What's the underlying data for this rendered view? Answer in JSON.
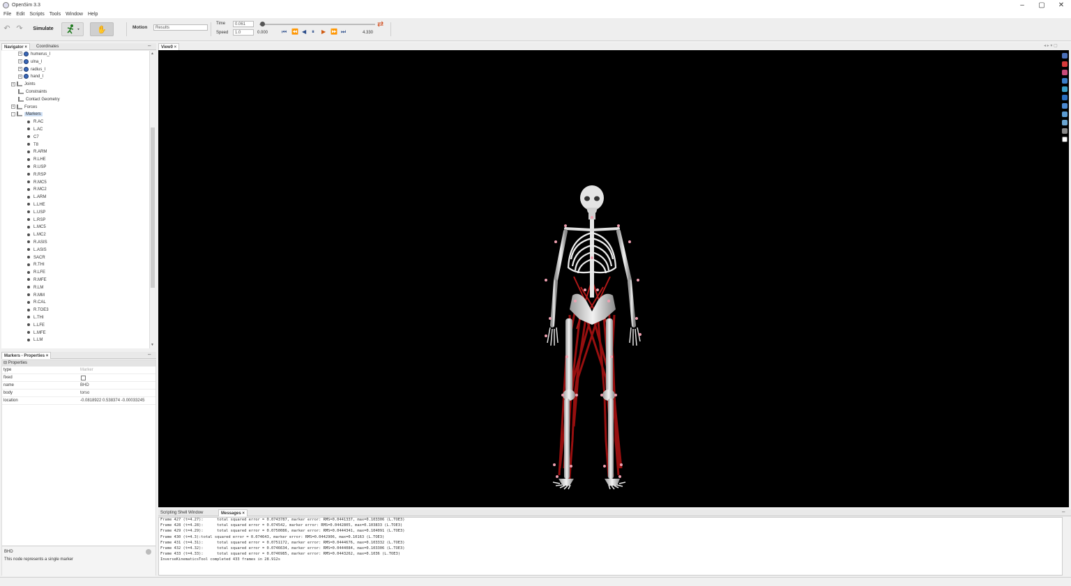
{
  "window": {
    "title": "OpenSim 3.3",
    "controls": [
      "–",
      "▢",
      "✕"
    ]
  },
  "menu": [
    "File",
    "Edit",
    "Scripts",
    "Tools",
    "Window",
    "Help"
  ],
  "toolbar": {
    "simulate_label": "Simulate",
    "motion_label": "Motion",
    "motion_value": "Results",
    "time_label": "Time",
    "time_value": "0.061",
    "speed_label": "Speed",
    "speed_value": "1.0",
    "range_start": "0.000",
    "range_end": "4.330"
  },
  "left_tabs": {
    "navigator": "Navigator",
    "coordinates": "Coordinates"
  },
  "tree": [
    {
      "label": "humerus_l",
      "kind": "body",
      "level": 2,
      "expander": "+"
    },
    {
      "label": "ulna_l",
      "kind": "body",
      "level": 2,
      "expander": "+"
    },
    {
      "label": "radius_l",
      "kind": "body",
      "level": 2,
      "expander": "+"
    },
    {
      "label": "hand_l",
      "kind": "body",
      "level": 2,
      "expander": "+"
    },
    {
      "label": "Joints",
      "kind": "group",
      "level": 1,
      "expander": "+"
    },
    {
      "label": "Constraints",
      "kind": "group",
      "level": 1,
      "expander": ""
    },
    {
      "label": "Contact Geometry",
      "kind": "group",
      "level": 1,
      "expander": ""
    },
    {
      "label": "Forces",
      "kind": "group",
      "level": 1,
      "expander": "+"
    },
    {
      "label": "Markers",
      "kind": "group",
      "level": 1,
      "expander": "-"
    },
    {
      "label": "R.AC",
      "kind": "marker",
      "level": 2
    },
    {
      "label": "L.AC",
      "kind": "marker",
      "level": 2
    },
    {
      "label": "C7",
      "kind": "marker",
      "level": 2
    },
    {
      "label": "T8",
      "kind": "marker",
      "level": 2
    },
    {
      "label": "R.ARM",
      "kind": "marker",
      "level": 2
    },
    {
      "label": "R.LHE",
      "kind": "marker",
      "level": 2
    },
    {
      "label": "R.USP",
      "kind": "marker",
      "level": 2
    },
    {
      "label": "R.RSP",
      "kind": "marker",
      "level": 2
    },
    {
      "label": "R.MC5",
      "kind": "marker",
      "level": 2
    },
    {
      "label": "R.MC2",
      "kind": "marker",
      "level": 2
    },
    {
      "label": "L.ARM",
      "kind": "marker",
      "level": 2
    },
    {
      "label": "L.LHE",
      "kind": "marker",
      "level": 2
    },
    {
      "label": "L.USP",
      "kind": "marker",
      "level": 2
    },
    {
      "label": "L.RSP",
      "kind": "marker",
      "level": 2
    },
    {
      "label": "L.MC5",
      "kind": "marker",
      "level": 2
    },
    {
      "label": "L.MC2",
      "kind": "marker",
      "level": 2
    },
    {
      "label": "R.ASIS",
      "kind": "marker",
      "level": 2
    },
    {
      "label": "L.ASIS",
      "kind": "marker",
      "level": 2
    },
    {
      "label": "SACR",
      "kind": "marker",
      "level": 2
    },
    {
      "label": "R.THI",
      "kind": "marker",
      "level": 2
    },
    {
      "label": "R.LFE",
      "kind": "marker",
      "level": 2
    },
    {
      "label": "R.MFE",
      "kind": "marker",
      "level": 2
    },
    {
      "label": "R.LM",
      "kind": "marker",
      "level": 2
    },
    {
      "label": "R.MM",
      "kind": "marker",
      "level": 2
    },
    {
      "label": "R.CAL",
      "kind": "marker",
      "level": 2
    },
    {
      "label": "R.TOE3",
      "kind": "marker",
      "level": 2
    },
    {
      "label": "L.THI",
      "kind": "marker",
      "level": 2
    },
    {
      "label": "L.LFE",
      "kind": "marker",
      "level": 2
    },
    {
      "label": "L.MFE",
      "kind": "marker",
      "level": 2
    },
    {
      "label": "L.LM",
      "kind": "marker",
      "level": 2
    }
  ],
  "props_tab": "Markers - Properties",
  "props_header": "Properties",
  "properties": [
    {
      "key": "type",
      "value": "Marker",
      "muted": true
    },
    {
      "key": "fixed",
      "value": "",
      "checkbox": true
    },
    {
      "key": "name",
      "value": "BHD"
    },
    {
      "key": "body",
      "value": "torso"
    },
    {
      "key": "location",
      "value": "-0.0818922 0.538374 -0.00033245"
    }
  ],
  "description": {
    "title": "BHD",
    "text": "This node represents a single marker"
  },
  "view_tab": "View0",
  "bottom_tabs": {
    "scripting": "Scripting Shell Window",
    "messages": "Messages"
  },
  "messages": [
    "Frame 427 (t=4.27):      total squared error = 0.0743787, marker error: RMS=0.0441337, max=0.103306 (L.TOE3)",
    "Frame 428 (t=4.28):      total squared error = 0.074542, marker error: RMS=0.0442805, max=0.103833 (L.TOE3)",
    "Frame 429 (t=4.29):      total squared error = 0.0750086, marker error: RMS=0.0444341, max=0.104091 (L.TOE3)",
    "Frame 430 (t=4.3):total squared error = 0.074643, marker error: RMS=0.0442906, max=0.10163 (L.TOE3)",
    "Frame 431 (t=4.31):      total squared error = 0.0751172, marker error: RMS=0.0444676, max=0.103332 (L.TOE3)",
    "Frame 432 (t=4.32):      total squared error = 0.0746634, marker error: RMS=0.0444084, max=0.103306 (L.TOE3)",
    "Frame 433 (t=4.33):      total squared error = 0.0746985, marker error: RMS=0.0443262, max=0.1036 (L.TOE3)",
    "InverseKinematicsTool completed 433 frames in 28.912s"
  ],
  "colors": {
    "muscle": "#a01010",
    "bone": "#d9d9d9",
    "marker": "#f0a0b0",
    "viewport_bg": "#000000",
    "loop": "#d04a1a"
  }
}
